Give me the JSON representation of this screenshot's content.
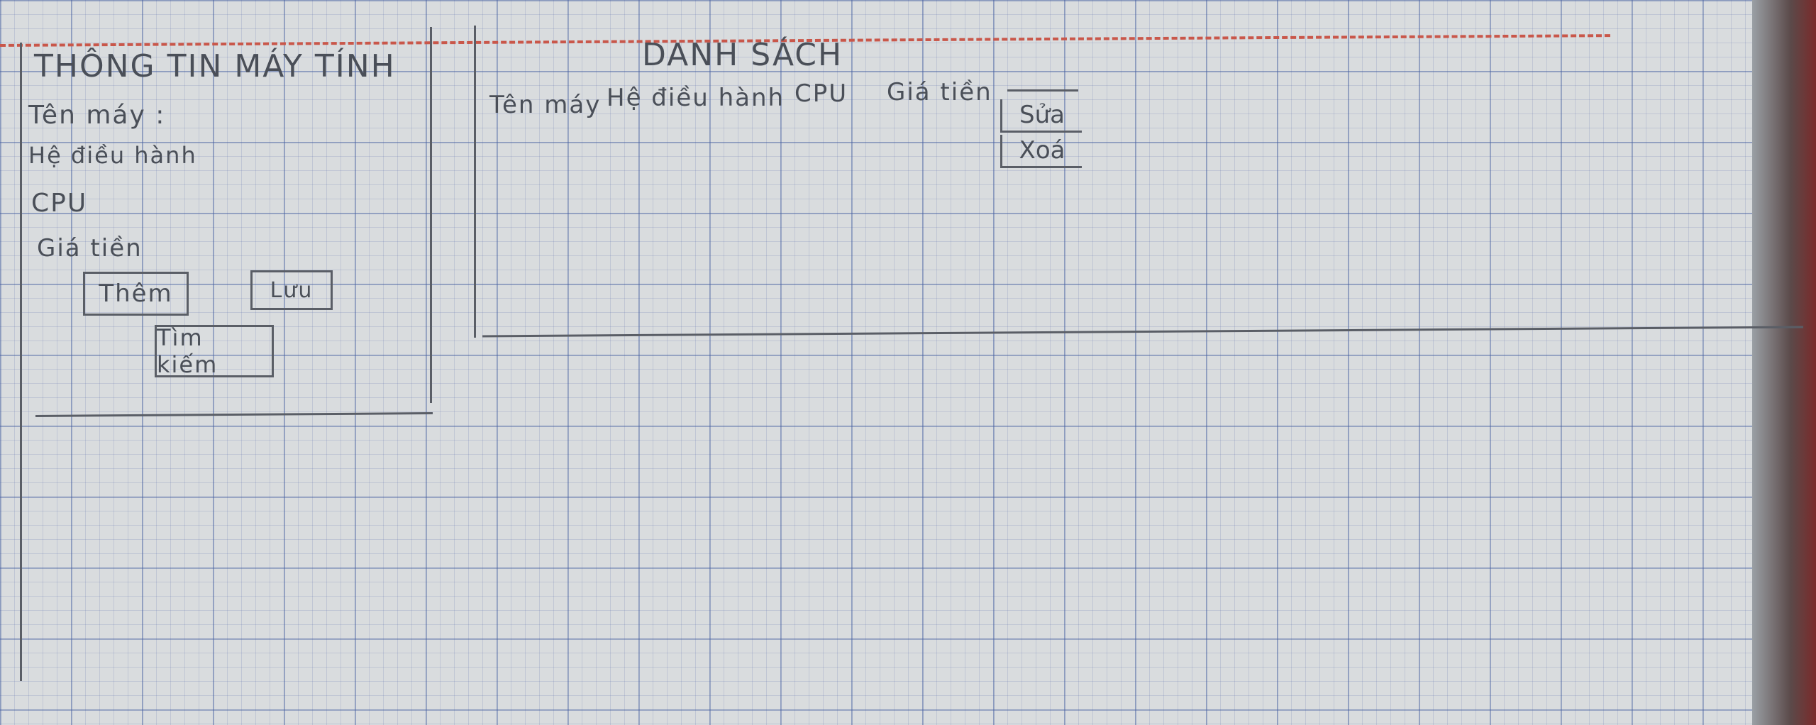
{
  "form_panel": {
    "title": "THÔNG TIN MÁY TÍNH",
    "fields": [
      {
        "label": "Tên máy :"
      },
      {
        "label": "Hệ điều hành"
      },
      {
        "label": "CPU"
      },
      {
        "label": "Giá tiền"
      }
    ],
    "buttons": {
      "add": "Thêm",
      "save": "Lưu",
      "search": "Tìm kiếm"
    }
  },
  "list_panel": {
    "title": "DANH SÁCH",
    "columns": [
      "Tên máy",
      "Hệ điều hành",
      "CPU",
      "Giá tiền"
    ],
    "row_actions": {
      "edit": "Sửa",
      "delete": "Xoá"
    }
  }
}
